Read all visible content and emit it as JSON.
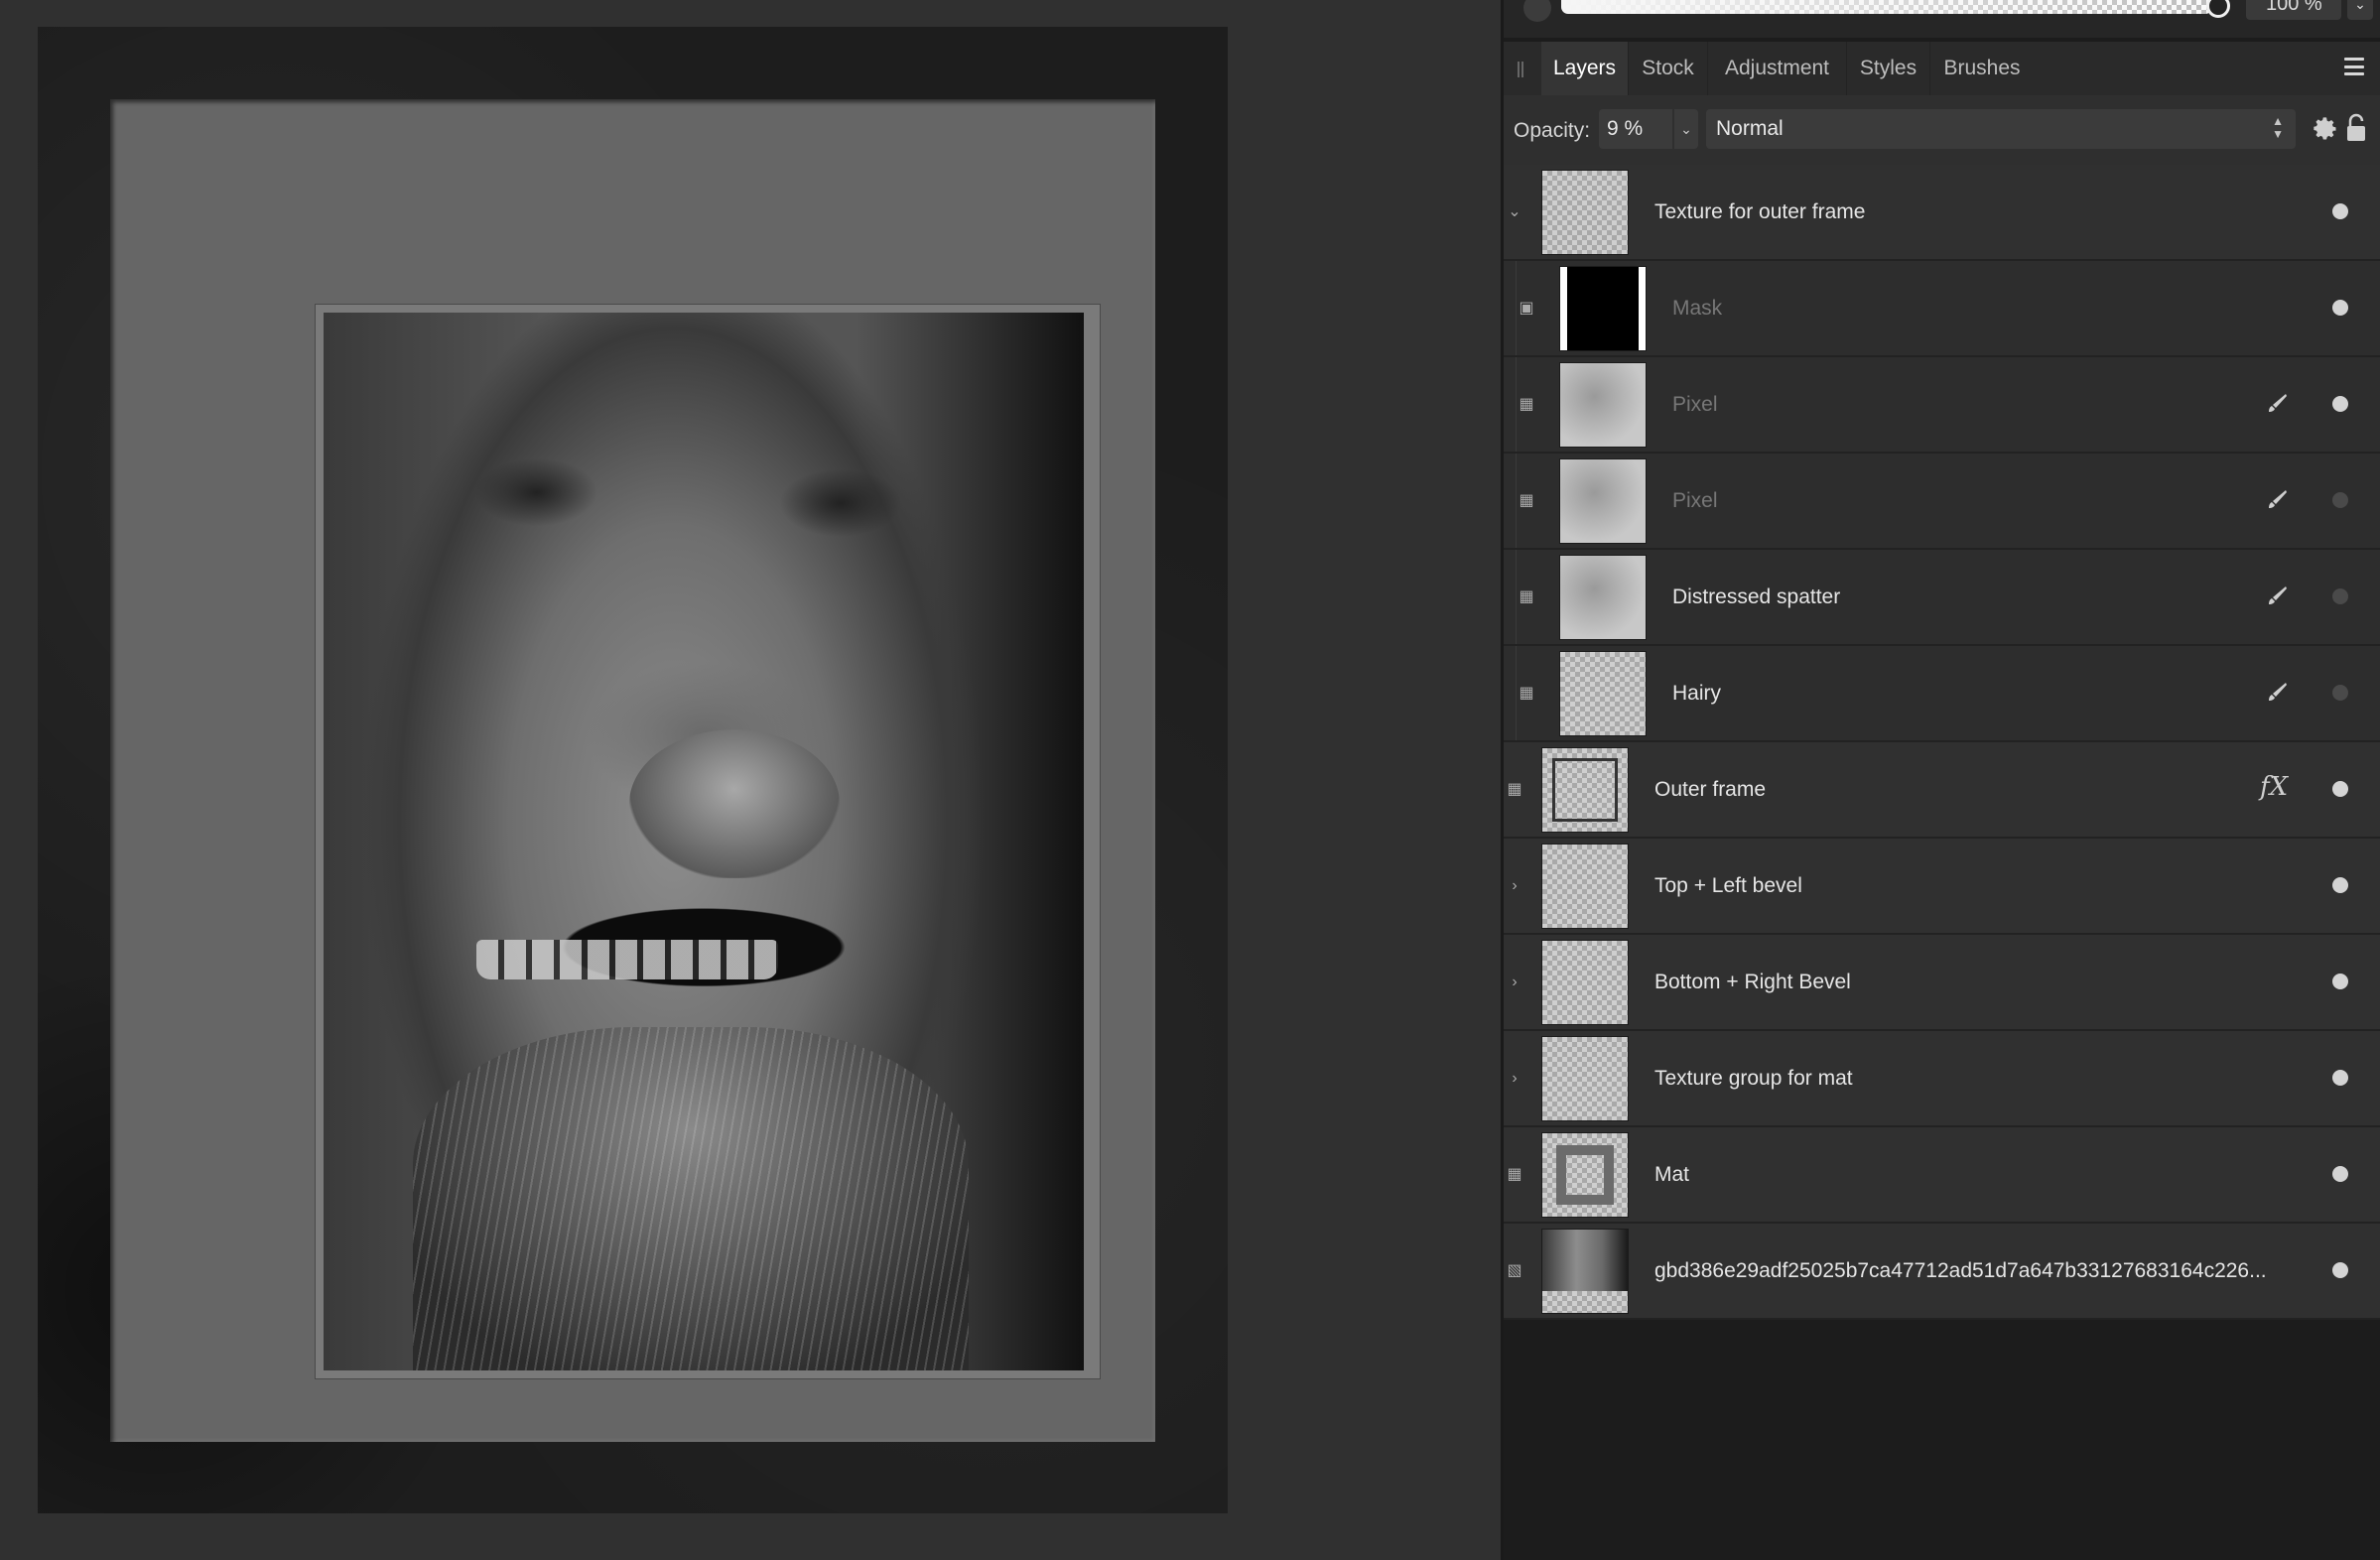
{
  "window": {
    "top_opacity_value": "100 %"
  },
  "tabs": [
    {
      "label": "Layers",
      "active": true
    },
    {
      "label": "Stock",
      "active": false
    },
    {
      "label": "Adjustment",
      "active": false
    },
    {
      "label": "Styles",
      "active": false
    },
    {
      "label": "Brushes",
      "active": false
    }
  ],
  "layer_controls": {
    "opacity_label": "Opacity:",
    "opacity_value": "9 %",
    "blend_mode": "Normal"
  },
  "layers": [
    {
      "name": "Texture for outer frame",
      "kind": "group",
      "expanded": true,
      "visible": true,
      "dim": false
    },
    {
      "name": "Mask",
      "kind": "mask",
      "visible": true,
      "dim": true
    },
    {
      "name": "Pixel",
      "kind": "pixel",
      "visible": true,
      "dim": true
    },
    {
      "name": "Pixel",
      "kind": "pixel",
      "visible": false,
      "dim": true
    },
    {
      "name": "Distressed spatter",
      "kind": "pixel",
      "visible": false,
      "dim": false
    },
    {
      "name": "Hairy",
      "kind": "pixel",
      "visible": false,
      "dim": false
    },
    {
      "name": "Outer frame",
      "kind": "shape",
      "has_fx": true,
      "fx_label": "fX",
      "visible": true,
      "dim": false
    },
    {
      "name": "Top + Left bevel",
      "kind": "group",
      "expanded": false,
      "visible": true,
      "dim": false
    },
    {
      "name": "Bottom + Right Bevel",
      "kind": "group",
      "expanded": false,
      "visible": true,
      "dim": false
    },
    {
      "name": "Texture group for mat",
      "kind": "group",
      "expanded": false,
      "visible": true,
      "dim": false
    },
    {
      "name": "Mat",
      "kind": "shape",
      "visible": true,
      "dim": false
    },
    {
      "name": "gbd386e29adf25025b7ca47712ad51d7a647b33127683164c226...",
      "kind": "image",
      "visible": true,
      "dim": false
    }
  ],
  "colors": {
    "panel_bg": "#1c1c1c",
    "row_bg": "#303030",
    "active_tab_bg": "#353535",
    "mat": "#666666",
    "outer_frame": "#1d1d1d"
  }
}
